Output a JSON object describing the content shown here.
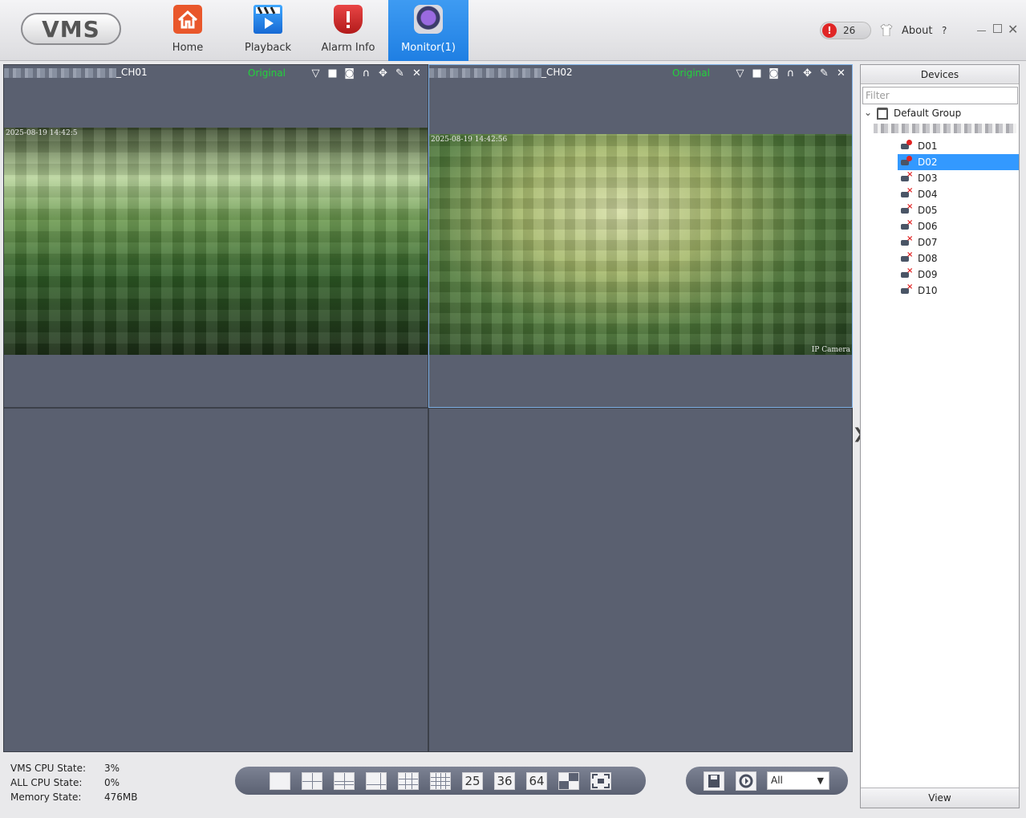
{
  "app": {
    "logo_text": "VMS"
  },
  "nav": {
    "home": "Home",
    "playback": "Playback",
    "alarm_info": "Alarm Info",
    "monitor": "Monitor(1)"
  },
  "topright": {
    "alarm_count": "26",
    "alarm_badge": "!",
    "about": "About",
    "help": "?"
  },
  "panes": [
    {
      "title_suffix": "_CH01",
      "stream": "Original",
      "timestamp": "2025-08-19 14:42:5",
      "overlay": ""
    },
    {
      "title_suffix": "_CH02",
      "stream": "Original",
      "timestamp": "2025-08-19 14:42:56",
      "overlay": "IP Camera"
    }
  ],
  "devices": {
    "header": "Devices",
    "filter_placeholder": "Filter",
    "group": "Default Group",
    "items": [
      {
        "label": "D01",
        "online": true
      },
      {
        "label": "D02",
        "online": true,
        "selected": true
      },
      {
        "label": "D03",
        "online": false
      },
      {
        "label": "D04",
        "online": false
      },
      {
        "label": "D05",
        "online": false
      },
      {
        "label": "D06",
        "online": false
      },
      {
        "label": "D07",
        "online": false
      },
      {
        "label": "D08",
        "online": false
      },
      {
        "label": "D09",
        "online": false
      },
      {
        "label": "D10",
        "online": false
      }
    ],
    "footer": "View"
  },
  "status": {
    "vms_cpu_label": "VMS CPU State:",
    "vms_cpu_value": "3%",
    "all_cpu_label": "ALL CPU State:",
    "all_cpu_value": "0%",
    "memory_label": "Memory State:",
    "memory_value": "476MB"
  },
  "layout": {
    "n25": "25",
    "n36": "36",
    "n64": "64"
  },
  "controls": {
    "filter_value": "All"
  },
  "colors": {
    "accent": "#2a88ea",
    "stream_text": "#22d33b",
    "selected_row": "#3399ff",
    "pane_bg": "#5a6070"
  }
}
